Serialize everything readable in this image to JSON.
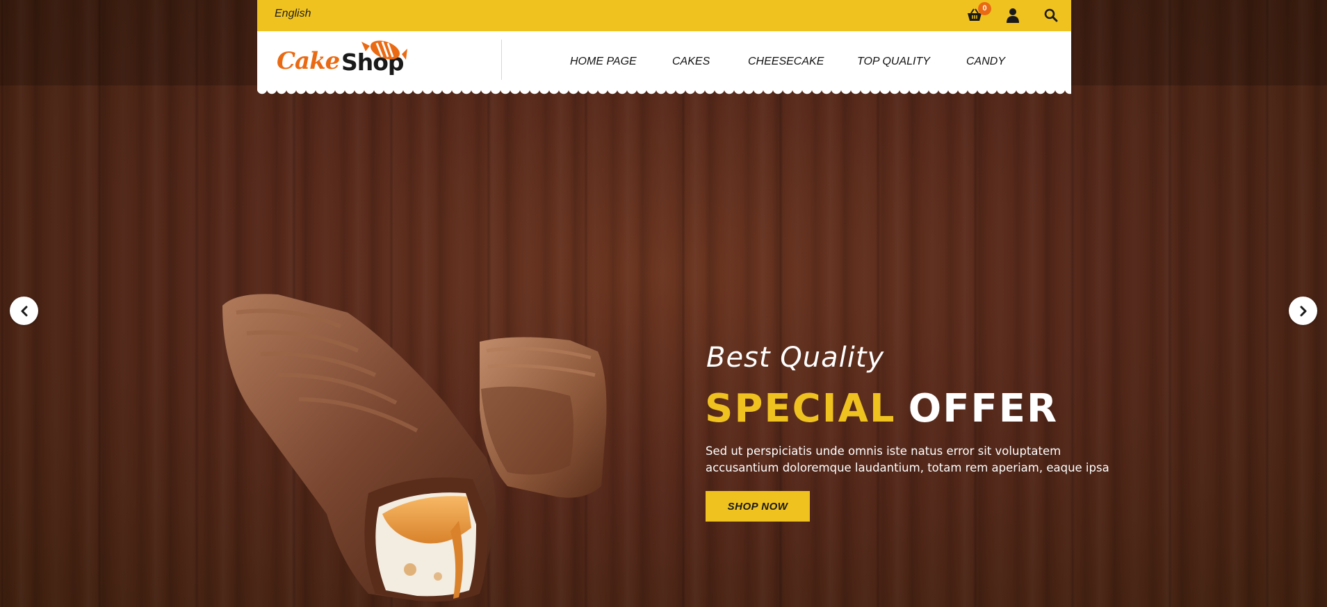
{
  "topbar": {
    "language": "English",
    "cart_count": "0",
    "icons": [
      "basket-icon",
      "user-icon",
      "search-icon"
    ]
  },
  "logo": {
    "word1": "Cake",
    "word2": "Shop"
  },
  "nav": {
    "items": [
      {
        "label": "HOME PAGE"
      },
      {
        "label": "CAKES"
      },
      {
        "label": "CHEESECAKE"
      },
      {
        "label": "TOP QUALITY"
      },
      {
        "label": "CANDY"
      }
    ]
  },
  "hero": {
    "subtitle": "Best Quality",
    "title_word1": "SPECIAL",
    "title_word2": "OFFER",
    "description_line1": "Sed ut perspiciatis unde omnis iste natus error sit voluptatem",
    "description_line2": "accusantium doloremque laudantium, totam rem aperiam, eaque ipsa",
    "button_label": "SHOP NOW"
  },
  "colors": {
    "accent_yellow": "#f0c220",
    "brand_orange": "#ea6a13",
    "wood_brown": "#55281a"
  }
}
